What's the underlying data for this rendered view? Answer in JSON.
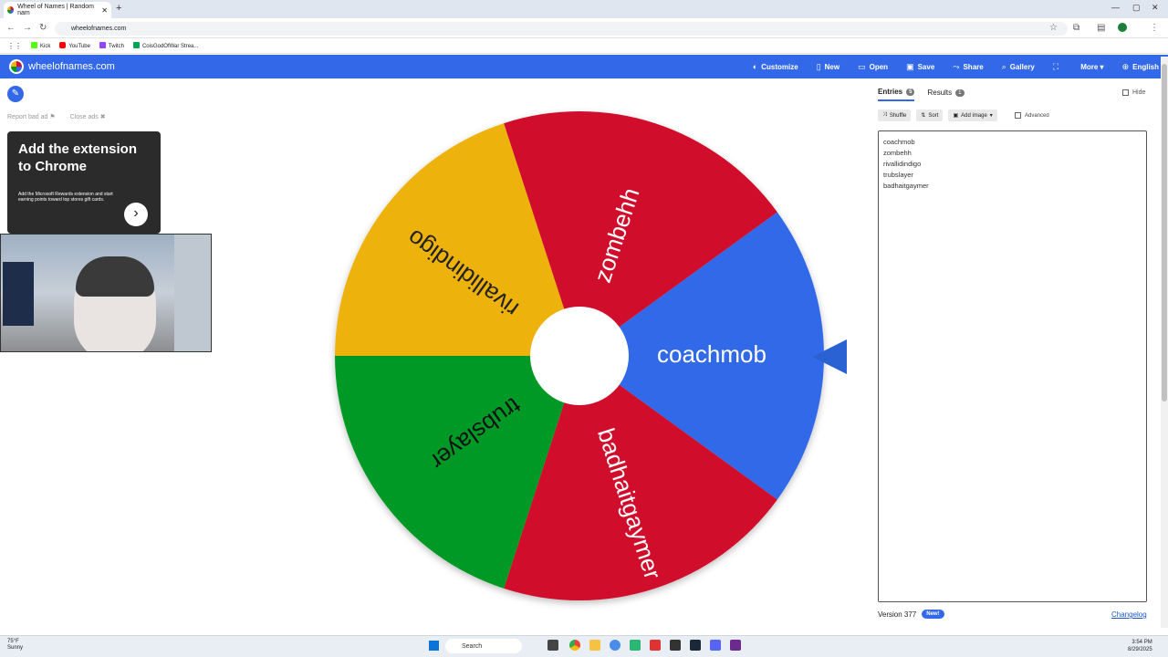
{
  "browser": {
    "tab_title": "Wheel of Names | Random nam",
    "url": "wheelofnames.com",
    "bookmarks": [
      {
        "label": "Kick",
        "color": "#53fc18"
      },
      {
        "label": "YouTube",
        "color": "#ff0000"
      },
      {
        "label": "Twitch",
        "color": "#9146ff"
      },
      {
        "label": "CoisGodOfWar Strea...",
        "color": "#00a651"
      }
    ]
  },
  "header": {
    "site_name": "wheelofnames.com",
    "menu": [
      {
        "label": "Customize",
        "icon": "palette-icon",
        "glyph": "◐"
      },
      {
        "label": "New",
        "icon": "file-icon",
        "glyph": "▯"
      },
      {
        "label": "Open",
        "icon": "folder-icon",
        "glyph": "▭"
      },
      {
        "label": "Save",
        "icon": "save-icon",
        "glyph": "▣"
      },
      {
        "label": "Share",
        "icon": "share-icon",
        "glyph": "⤳"
      },
      {
        "label": "Gallery",
        "icon": "search-icon",
        "glyph": "⌕"
      },
      {
        "label": "",
        "icon": "fullscreen-icon",
        "glyph": "⛶"
      },
      {
        "label": "More ▾",
        "icon": "",
        "glyph": ""
      },
      {
        "label": "English",
        "icon": "globe-icon",
        "glyph": "⊕"
      }
    ]
  },
  "ads": {
    "report": "Report bad ad",
    "close": "Close ads",
    "title": "Add the extension to Chrome",
    "body": "Add the Microsoft Rewards extension and start earning points toward top stores gift cards."
  },
  "wheel": {
    "slices": [
      {
        "name": "coachmob",
        "color": "#3369e8"
      },
      {
        "name": "badhaitgaymer",
        "color": "#d0112b"
      },
      {
        "name": "trubslayer",
        "color": "#009925"
      },
      {
        "name": "rivallidindigo",
        "color": "#eeb211"
      },
      {
        "name": "zombehh",
        "color": "#d0112b"
      }
    ],
    "start_angle_deg": -36
  },
  "panel": {
    "entries_tab": "Entries",
    "entries_count": "5",
    "results_tab": "Results",
    "results_count": "1",
    "hide_label": "Hide",
    "shuffle": "Shuffle",
    "sort": "Sort",
    "add_image": "Add image",
    "advanced": "Advanced",
    "entries": [
      "coachmob",
      "zombehh",
      "rivallidindigo",
      "trubslayer",
      "badhaitgaymer"
    ],
    "version": "Version 377",
    "new_badge": "New!",
    "changelog": "Changelog"
  },
  "taskbar": {
    "weather_temp": "75°F",
    "weather_desc": "Sunny",
    "search": "Search",
    "time": "3:54 PM",
    "date": "8/29/2025"
  }
}
